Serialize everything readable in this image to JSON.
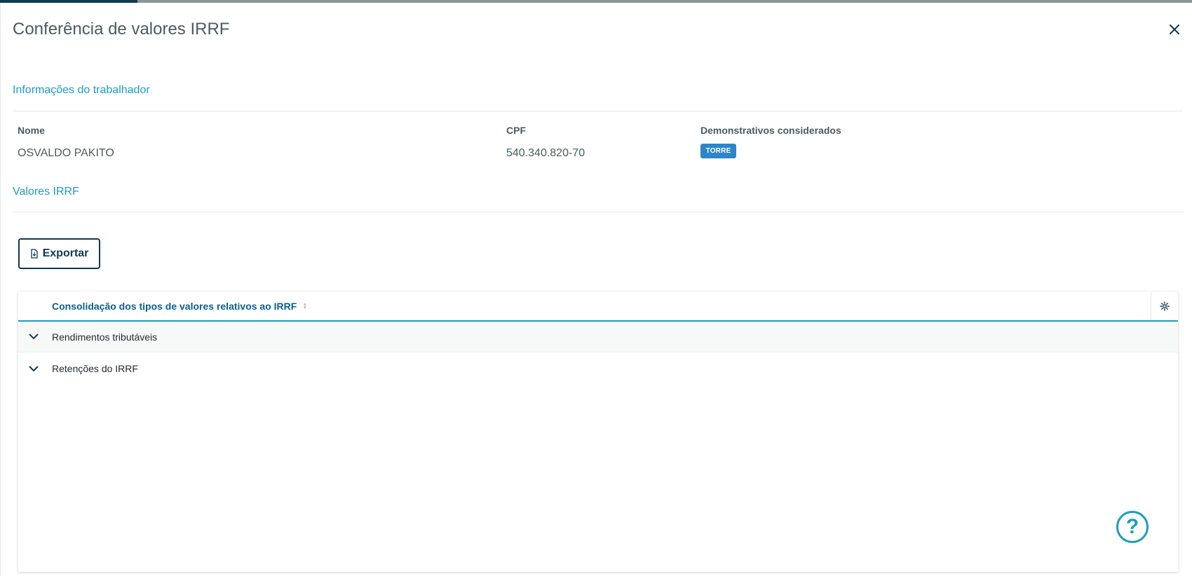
{
  "modal": {
    "title": "Conferência de valores IRRF"
  },
  "worker_info": {
    "section_title": "Informações do trabalhador",
    "name_label": "Nome",
    "name_value": "OSVALDO PAKITO",
    "cpf_label": "CPF",
    "cpf_value": "540.340.820-70",
    "statements_label": "Demonstrativos considerados",
    "statements_tag": "TORRE"
  },
  "irrf_values": {
    "section_title": "Valores IRRF",
    "export_label": "Exportar"
  },
  "table": {
    "header": "Consolidação dos tipos de valores relativos ao IRRF",
    "rows": [
      {
        "label": "Rendimentos tributáveis"
      },
      {
        "label": "Retenções do IRRF"
      }
    ]
  },
  "help": {
    "glyph": "?"
  },
  "colors": {
    "accent": "#1d9dbd",
    "primary": "#0c3a52",
    "tag": "#2e86c9"
  }
}
